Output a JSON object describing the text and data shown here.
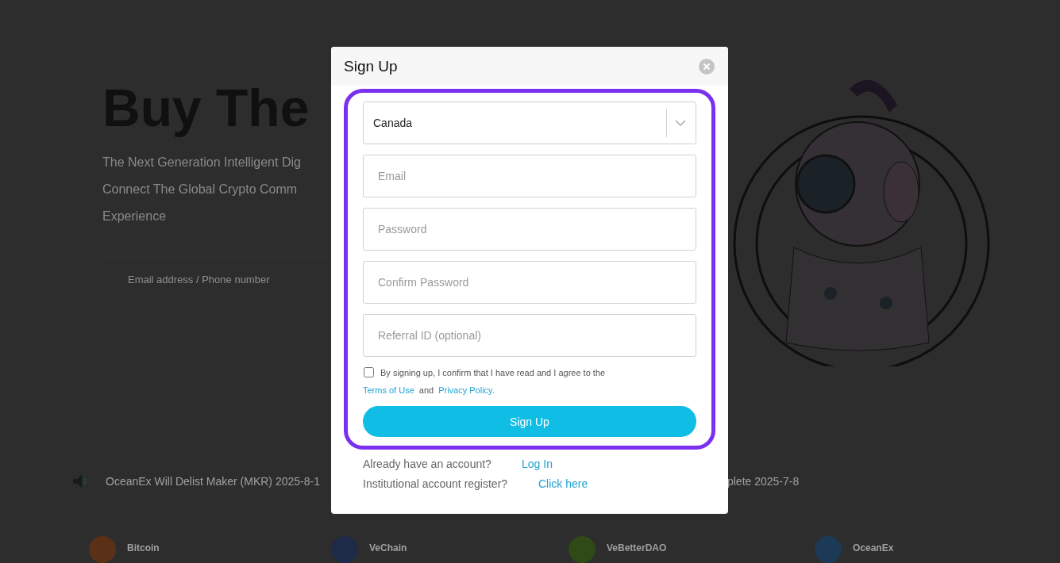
{
  "background": {
    "headline": "Buy The",
    "subtitle_lines": [
      "The Next Generation Intelligent Dig",
      "Connect The Global Crypto Comm",
      "Experience"
    ],
    "email_placeholder": "Email address / Phone number",
    "news": [
      {
        "text": "OceanEx Will Delist Maker (MKR) 2025-8-1"
      },
      {
        "text": "plete 2025-7-8"
      }
    ],
    "coins": [
      {
        "name": "Bitcoin",
        "color": "#5a3116"
      },
      {
        "name": "VeChain",
        "color": "#1d2b48"
      },
      {
        "name": "VeBetterDAO",
        "color": "#2f4a16"
      },
      {
        "name": "OceanEx",
        "color": "#1c3a55"
      }
    ]
  },
  "dialog": {
    "title": "Sign Up",
    "country": "Canada",
    "fields": [
      {
        "placeholder": "Email"
      },
      {
        "placeholder": "Password"
      },
      {
        "placeholder": "Confirm Password"
      },
      {
        "placeholder": "Referral ID (optional)"
      }
    ],
    "agreement": {
      "checked": false,
      "text": "By signing up, I confirm that I have read and I agree to the",
      "terms_link": "Terms of Use",
      "joiner": "and",
      "privacy_link": "Privacy Policy."
    },
    "submit": "Sign Up",
    "footer": [
      {
        "text": "Already have an account?",
        "link": "Log In"
      },
      {
        "text": "Institutional account register?",
        "link": "Click here"
      }
    ]
  }
}
